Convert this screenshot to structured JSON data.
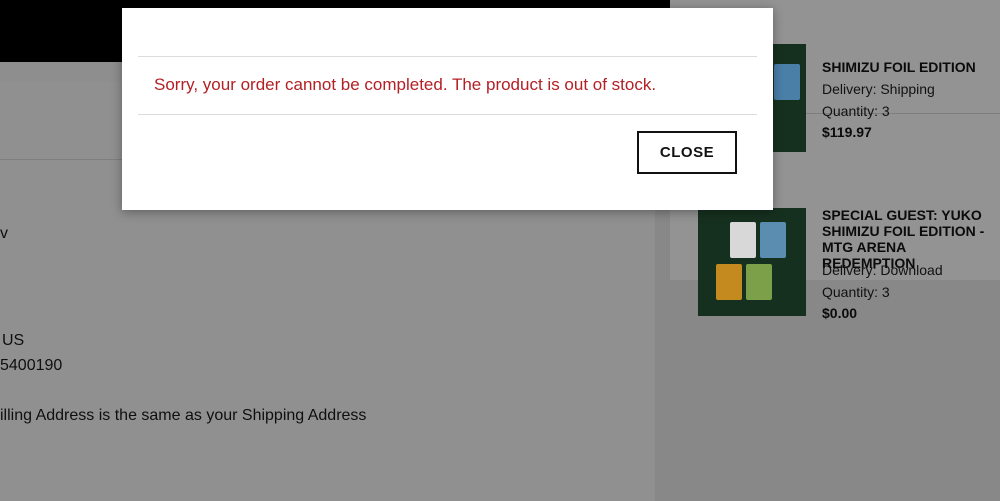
{
  "modal": {
    "message": "Sorry, your order cannot be completed. The product is out of stock.",
    "close_label": "CLOSE"
  },
  "left": {
    "line_v": "v",
    "country": "US",
    "phone": "5400190",
    "billing_note": "illing Address is the same as your Shipping Address"
  },
  "cart": {
    "items": [
      {
        "title": "SHIMIZU FOIL EDITION",
        "delivery": "Delivery: Shipping",
        "quantity": "Quantity: 3",
        "price": "$119.97"
      },
      {
        "title": "SPECIAL GUEST: YUKO SHIMIZU FOIL EDITION - MTG ARENA REDEMPTION",
        "delivery": "Delivery: Download",
        "quantity": "Quantity: 3",
        "price": "$0.00"
      }
    ]
  }
}
